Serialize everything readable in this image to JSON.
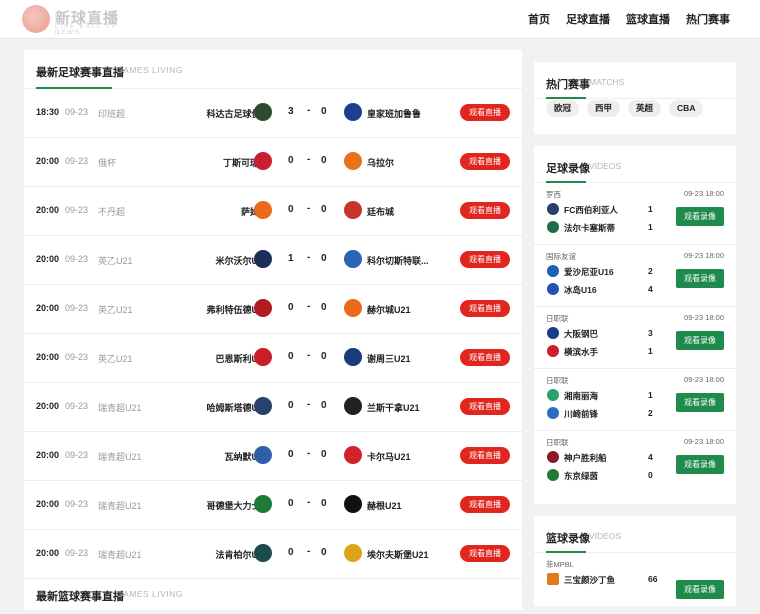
{
  "header": {
    "logo_text": "新球直播",
    "logo_sub": "LIVE  BALL  TV  NEWS",
    "nav": [
      "首页",
      "足球直播",
      "篮球直播",
      "热门赛事"
    ]
  },
  "football_live": {
    "title": "最新足球赛事直播",
    "subtitle": "GAMES LIVING",
    "button_label": "观看直播",
    "matches": [
      {
        "time": "18:30",
        "date": "09-23",
        "league": "印班超",
        "home": "科达古足球俱...",
        "home_score": "3",
        "dash": "-",
        "away_score": "0",
        "away": "皇家班加鲁鲁",
        "home_color": "#2d4a2f",
        "away_color": "#1d3f8f"
      },
      {
        "time": "20:00",
        "date": "09-23",
        "league": "俄杯",
        "home": "丁斯可瑞旺",
        "home_score": "0",
        "dash": "-",
        "away_score": "0",
        "away": "乌拉尔",
        "home_color": "#c8202e",
        "away_color": "#e8731a"
      },
      {
        "time": "20:00",
        "date": "09-23",
        "league": "不丹超",
        "home": "萨姆策",
        "home_score": "0",
        "dash": "-",
        "away_score": "0",
        "away": "廷布城",
        "home_color": "#e86a1a",
        "away_color": "#c5352b"
      },
      {
        "time": "20:00",
        "date": "09-23",
        "league": "英乙U21",
        "home": "米尔沃尔U21",
        "home_score": "1",
        "dash": "-",
        "away_score": "0",
        "away": "科尔切斯特联...",
        "home_color": "#1c2f5c",
        "away_color": "#2b63b5"
      },
      {
        "time": "20:00",
        "date": "09-23",
        "league": "英乙U21",
        "home": "弗利特伍德U21",
        "home_score": "0",
        "dash": "-",
        "away_score": "0",
        "away": "赫尔城U21",
        "home_color": "#b11c22",
        "away_color": "#e86a1a"
      },
      {
        "time": "20:00",
        "date": "09-23",
        "league": "英乙U21",
        "home": "巴恩斯利U21",
        "home_score": "0",
        "dash": "-",
        "away_score": "0",
        "away": "谢周三U21",
        "home_color": "#c81e25",
        "away_color": "#1b3c7a"
      },
      {
        "time": "20:00",
        "date": "09-23",
        "league": "瑞青超U21",
        "home": "哈姆斯塔德U21",
        "home_score": "0",
        "dash": "-",
        "away_score": "0",
        "away": "兰斯干拿U21",
        "home_color": "#27426e",
        "away_color": "#222222"
      },
      {
        "time": "20:00",
        "date": "09-23",
        "league": "瑞青超U21",
        "home": "瓦纳默U21",
        "home_score": "0",
        "dash": "-",
        "away_score": "0",
        "away": "卡尔马U21",
        "home_color": "#2f5fa8",
        "away_color": "#d3232a"
      },
      {
        "time": "20:00",
        "date": "09-23",
        "league": "瑞青超U21",
        "home": "哥德堡大力士...",
        "home_score": "0",
        "dash": "-",
        "away_score": "0",
        "away": "赫根U21",
        "home_color": "#1f7a3a",
        "away_color": "#111111"
      },
      {
        "time": "20:00",
        "date": "09-23",
        "league": "瑞青超U21",
        "home": "法肯柏尔U21",
        "home_score": "0",
        "dash": "-",
        "away_score": "0",
        "away": "埃尔夫斯堡U21",
        "home_color": "#1d4a4a",
        "away_color": "#e0a21a"
      }
    ]
  },
  "basketball_live": {
    "title": "最新篮球赛事直播",
    "subtitle": "GAMES LIVING"
  },
  "hot_matches": {
    "title": "热门赛事",
    "subtitle": "MATCHS",
    "tags": [
      "欧冠",
      "西甲",
      "英超",
      "CBA"
    ]
  },
  "football_videos": {
    "title": "足球录像",
    "subtitle": "VIDEOS",
    "button_label": "观看录像",
    "items": [
      {
        "league": "罗西",
        "time": "09-23 18:00",
        "team1": "FC西伯利亚人",
        "score1": "1",
        "team2": "法尔卡塞斯蒂",
        "score2": "1",
        "c1": "#2a3f6a",
        "c2": "#1f6b4a"
      },
      {
        "league": "国际友谊",
        "time": "09-23 18:00",
        "team1": "爱沙尼亚U16",
        "score1": "2",
        "team2": "冰岛U16",
        "score2": "4",
        "c1": "#1c63b6",
        "c2": "#2a4fb3"
      },
      {
        "league": "日职联",
        "time": "09-23 18:00",
        "team1": "大阪钢巴",
        "score1": "3",
        "team2": "横滨水手",
        "score2": "1",
        "c1": "#1a3c8a",
        "c2": "#c8202e"
      },
      {
        "league": "日职联",
        "time": "09-23 18:00",
        "team1": "湘南丽海",
        "score1": "1",
        "team2": "川崎前锋",
        "score2": "2",
        "c1": "#2aa06a",
        "c2": "#2b6cc4"
      },
      {
        "league": "日职联",
        "time": "09-23 18:00",
        "team1": "神户胜利船",
        "score1": "4",
        "team2": "东京绿茵",
        "score2": "0",
        "c1": "#8a1a2a",
        "c2": "#1f7a3a"
      }
    ]
  },
  "basketball_videos": {
    "title": "篮球录像",
    "subtitle": "VIDEOS",
    "items": [
      {
        "league": "菲MPBL",
        "team1": "三宝颜沙丁鱼",
        "score1": "66",
        "c1": "#e07a1a"
      }
    ]
  }
}
